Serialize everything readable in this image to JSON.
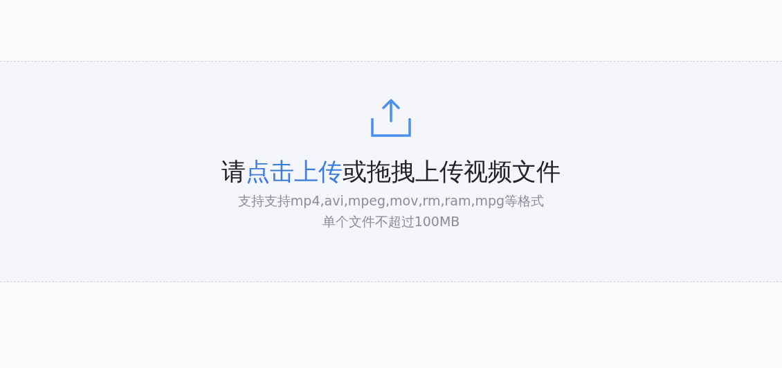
{
  "upload_area": {
    "prompt_before": "请",
    "prompt_link": "点击上传",
    "prompt_after": "或拖拽上传视频文件",
    "formats_note": "支持支持mp4,avi,mpeg,mov,rm,ram,mpg等格式",
    "size_note": "单个文件不超过100MB"
  }
}
